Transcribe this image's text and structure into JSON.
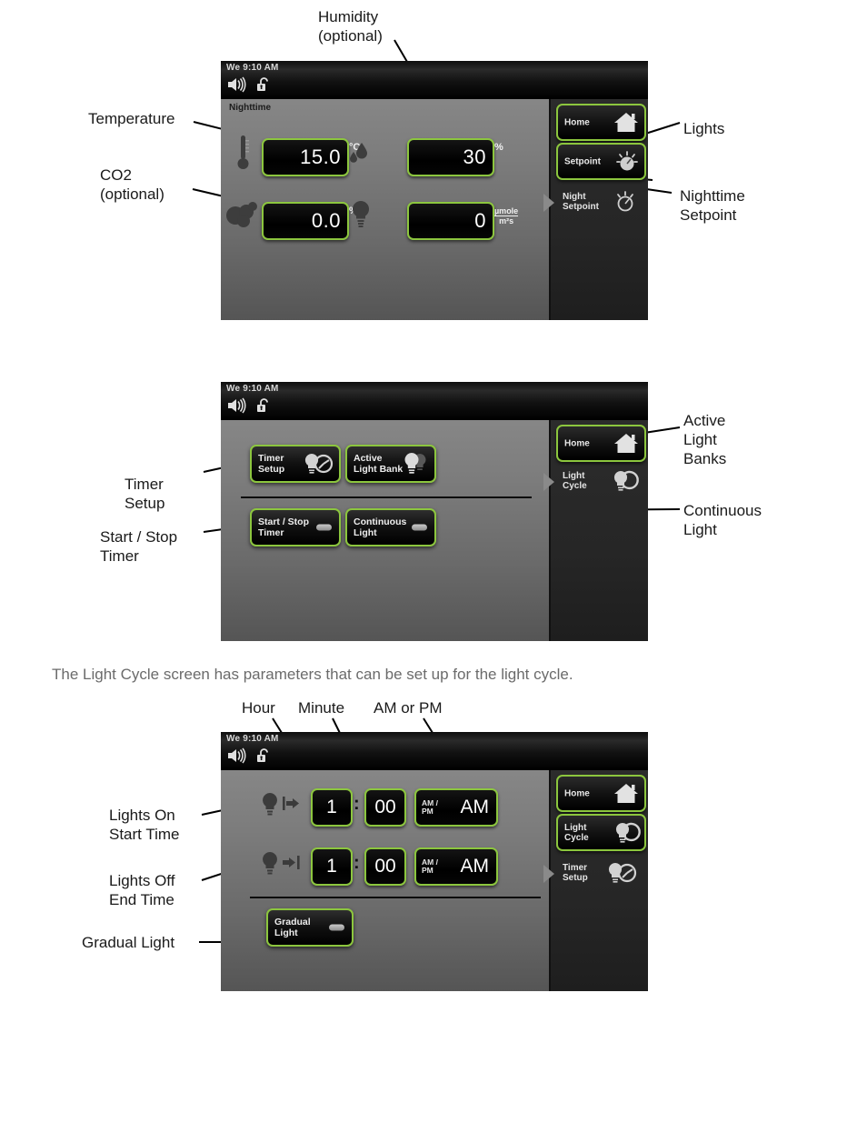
{
  "annotations": {
    "humidity": "Humidity\n(optional)",
    "temperature": "Temperature",
    "co2": "CO2\n(optional)",
    "lights": "Lights",
    "nighttime_setpoint": "Nighttime\nSetpoint",
    "timer_setup": "Timer\nSetup",
    "start_stop_timer": "Start / Stop\nTimer",
    "active_light_banks": "Active\nLight\nBanks",
    "continuous_light": "Continuous\nLight",
    "hour": "Hour",
    "minute": "Minute",
    "am_or_pm": "AM or PM",
    "lights_on_start_time": "Lights On\nStart Time",
    "lights_off_end_time": "Lights Off\nEnd Time",
    "gradual_light": "Gradual Light"
  },
  "paragraph": "The Light Cycle screen has parameters that can be set up for the light cycle.",
  "colors": {
    "accent_green": "#8cc63e",
    "screen_dark": "#000000",
    "sidebar": "#2c2c2c",
    "annotation_text": "#1a1a1a",
    "paragraph_text": "#6b6b6b"
  },
  "statusbar": {
    "time": "We  9:10 AM",
    "speaker_icon": "speaker-icon",
    "lock_icon": "unlock-icon"
  },
  "screen1": {
    "mode_label": "Nighttime",
    "fields": [
      {
        "name": "temperature",
        "icon": "thermometer-icon",
        "value": "15.0",
        "unit": "°C"
      },
      {
        "name": "humidity",
        "icon": "droplet-icon",
        "value": "30",
        "unit": "%"
      },
      {
        "name": "co2",
        "icon": "co2-cloud-icon",
        "value": "0.0",
        "unit": "%"
      },
      {
        "name": "light",
        "icon": "bulb-icon",
        "value": "0",
        "unit_num": "µmole",
        "unit_den": "m²s"
      }
    ],
    "sidebar": [
      {
        "label": "Home",
        "icon": "home-icon",
        "active": true,
        "selected": false
      },
      {
        "label": "Setpoint",
        "icon": "setpoint-dial-icon",
        "active": true,
        "selected": false
      },
      {
        "label": "Night\nSetpoint",
        "icon": "night-setpoint-dial-icon",
        "active": false,
        "selected": true
      }
    ]
  },
  "screen2": {
    "buttons": [
      {
        "label": "Timer\nSetup",
        "icon": "timer-setup-icon",
        "toggle": false
      },
      {
        "label": "Active\nLight Bank",
        "icon": "light-bank-icon",
        "toggle": false
      },
      {
        "label": "Start / Stop\nTimer",
        "icon": "toggle-switch",
        "toggle": true
      },
      {
        "label": "Continuous\nLight",
        "icon": "toggle-switch",
        "toggle": true
      }
    ],
    "sidebar": [
      {
        "label": "Home",
        "icon": "home-icon",
        "active": true,
        "selected": false
      },
      {
        "label": "Light\nCycle",
        "icon": "light-cycle-icon",
        "active": false,
        "selected": true
      }
    ]
  },
  "screen3": {
    "rows": [
      {
        "name": "lights-on",
        "icon": "bulb-start-icon",
        "hour": "1",
        "separator": ":",
        "minute": "00",
        "ampm_tag": "AM /\nPM",
        "ampm": "AM"
      },
      {
        "name": "lights-off",
        "icon": "bulb-end-icon",
        "hour": "1",
        "separator": ":",
        "minute": "00",
        "ampm_tag": "AM /\nPM",
        "ampm": "AM"
      }
    ],
    "gradual": {
      "label": "Gradual\nLight",
      "toggle": true
    },
    "sidebar": [
      {
        "label": "Home",
        "icon": "home-icon",
        "active": true,
        "selected": false
      },
      {
        "label": "Light\nCycle",
        "icon": "light-cycle-icon",
        "active": true,
        "selected": false
      },
      {
        "label": "Timer\nSetup",
        "icon": "timer-setup-icon",
        "active": false,
        "selected": true
      }
    ]
  }
}
